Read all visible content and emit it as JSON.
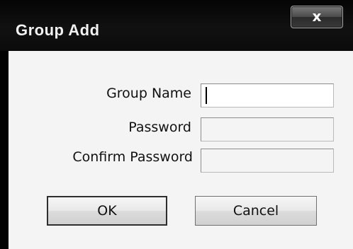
{
  "window": {
    "title": "Group Add",
    "close_glyph": "x"
  },
  "form": {
    "group_name_label": "Group Name",
    "group_name_value": "",
    "password_label": "Password",
    "password_value": "",
    "confirm_password_label": "Confirm Password",
    "confirm_password_value": ""
  },
  "buttons": {
    "ok_label": "OK",
    "cancel_label": "Cancel"
  },
  "icons": {
    "close": "close-icon"
  }
}
